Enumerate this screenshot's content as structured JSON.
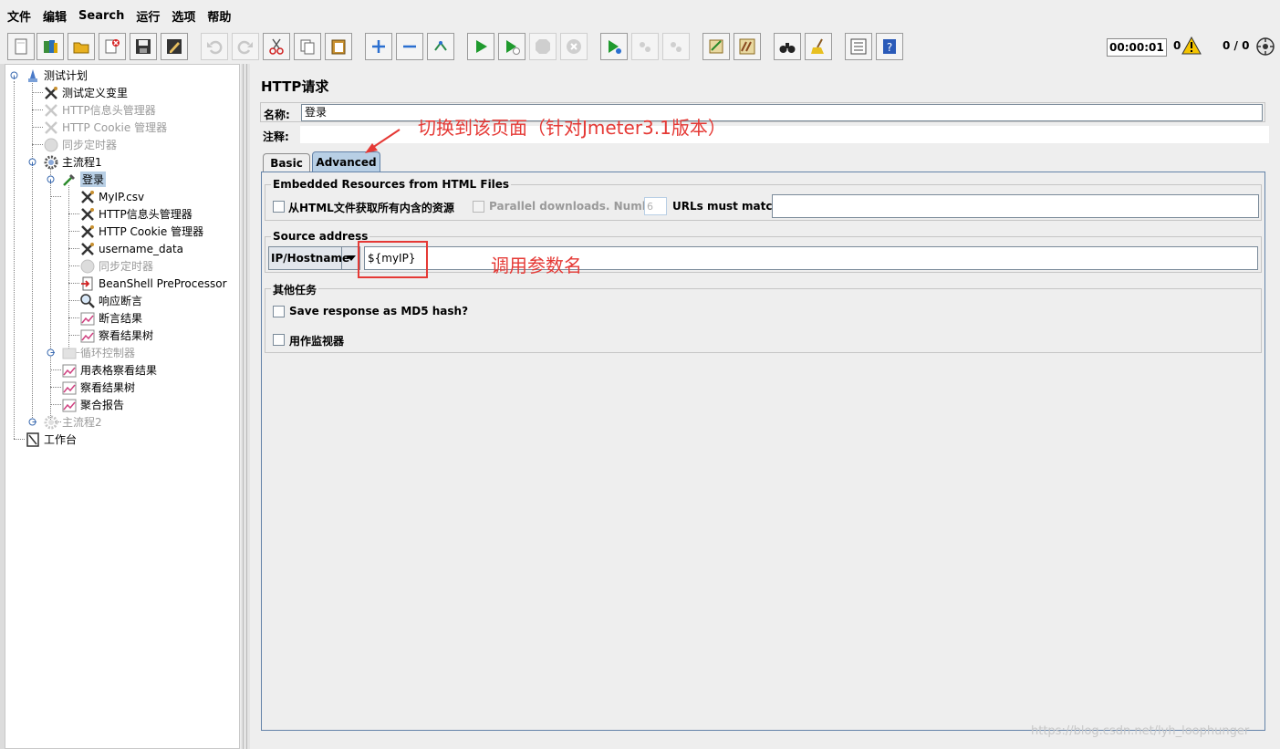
{
  "menu": [
    "文件",
    "编辑",
    "Search",
    "运行",
    "选项",
    "帮助"
  ],
  "status": {
    "timer": "00:00:01",
    "warnings": "0",
    "threads": "0 / 0"
  },
  "tree": {
    "items": [
      {
        "label": "测试计划"
      },
      {
        "label": "测试定义变里"
      },
      {
        "label": "HTTP信息头管理器"
      },
      {
        "label": "HTTP Cookie 管理器"
      },
      {
        "label": "同步定时器"
      },
      {
        "label": "主流程1"
      },
      {
        "label": "登录"
      },
      {
        "label": "MyIP.csv"
      },
      {
        "label": "HTTP信息头管理器"
      },
      {
        "label": "HTTP Cookie 管理器"
      },
      {
        "label": "username_data"
      },
      {
        "label": "同步定时器"
      },
      {
        "label": "BeanShell PreProcessor"
      },
      {
        "label": "响应断言"
      },
      {
        "label": "断言结果"
      },
      {
        "label": "察看结果树"
      },
      {
        "label": "循环控制器"
      },
      {
        "label": "用表格察看结果"
      },
      {
        "label": "察看结果树"
      },
      {
        "label": "聚合报告"
      },
      {
        "label": "主流程2"
      },
      {
        "label": "工作台"
      }
    ]
  },
  "panel": {
    "title": "HTTP请求",
    "name_label": "名称:",
    "name_value": "登录",
    "comment_label": "注释:",
    "tabs": [
      "Basic",
      "Advanced"
    ]
  },
  "embedded": {
    "title": "Embedded Resources from HTML Files",
    "fetch_label": "从HTML文件获取所有内含的资源",
    "parallel_label": "Parallel downloads. Number:",
    "parallel_value": "6",
    "urls_label": "URLs must match:"
  },
  "source": {
    "title": "Source address",
    "type": "IP/Hostname",
    "value": "${myIP}"
  },
  "other": {
    "title": "其他任务",
    "md5_label": "Save response as MD5 hash?",
    "monitor_label": "用作监视器"
  },
  "annotations": {
    "tab_note": "切换到该页面（针对Jmeter3.1版本）",
    "param_note": "调用参数名"
  },
  "watermark": "https://blog.csdn.net/lyh_loophunger",
  "colors": {
    "selection": "#b8cfe5",
    "annotation_red": "#e53935",
    "tab_border": "#6382a8"
  }
}
